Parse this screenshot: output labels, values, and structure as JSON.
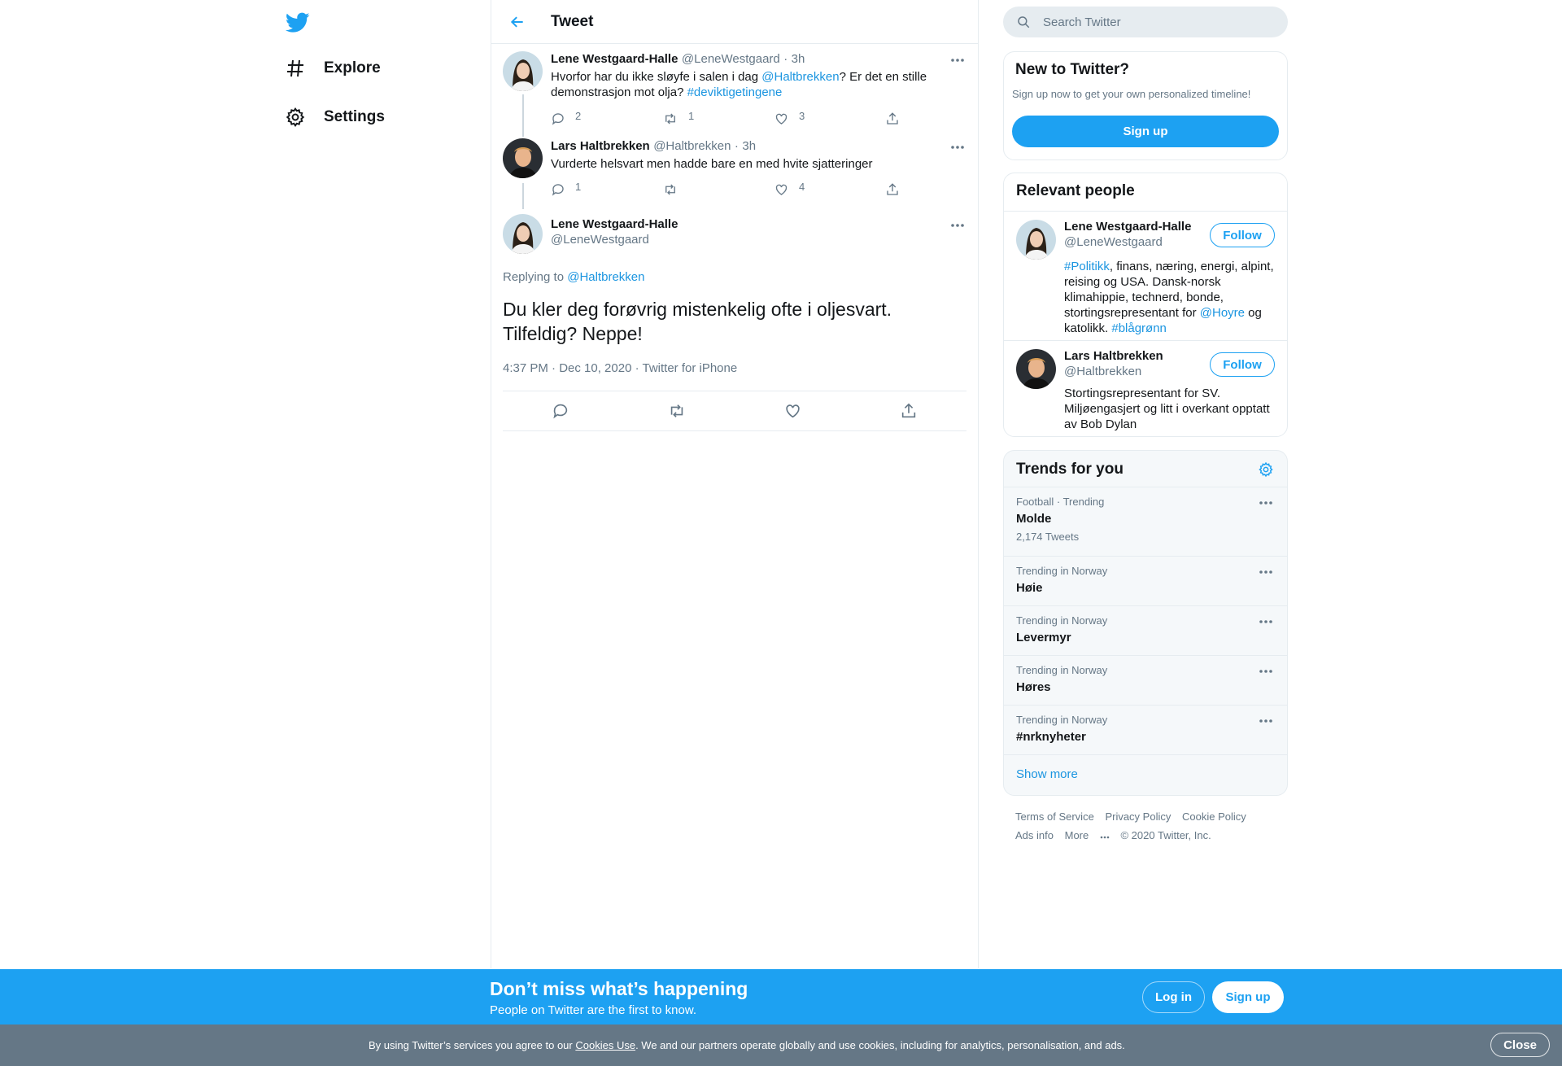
{
  "app": {
    "accent": "#1da1f2",
    "link_color": "#1b95e0"
  },
  "nav": {
    "logo_icon": "twitter-bird-icon",
    "items": [
      {
        "label": "Explore",
        "icon": "hashtag-icon"
      },
      {
        "label": "Settings",
        "icon": "gear-icon"
      }
    ]
  },
  "header": {
    "title": "Tweet",
    "back_icon": "arrow-left-icon"
  },
  "thread": [
    {
      "name": "Lene Westgaard-Halle",
      "handle": "@LeneWestgaard",
      "sep": "·",
      "time": "3h",
      "text_parts": [
        "Hvorfor har du ikke sløyfe i salen i dag ",
        "@Haltbrekken",
        "? Er det en stille demonstrasjon mot olja? ",
        "#deviktigetingene"
      ],
      "replies": "2",
      "retweets": "1",
      "likes": "3"
    },
    {
      "name": "Lars Haltbrekken",
      "handle": "@Haltbrekken",
      "sep": "·",
      "time": "3h",
      "text": "Vurderte helsvart men hadde bare en med hvite sjatteringer",
      "replies": "1",
      "retweets": "",
      "likes": "4"
    }
  ],
  "focal": {
    "name": "Lene Westgaard-Halle",
    "handle": "@LeneWestgaard",
    "replying_prefix": "Replying to ",
    "replying_to": "@Haltbrekken",
    "text_line1": "Du kler deg forøvrig mistenkelig ofte i oljesvart.",
    "text_line2": "Tilfeldig? Neppe!",
    "meta": "4:37 PM · Dec 10, 2020 · Twitter for iPhone"
  },
  "search": {
    "placeholder": "Search Twitter"
  },
  "new_to_twitter": {
    "title": "New to Twitter?",
    "subtitle": "Sign up now to get your own personalized timeline!",
    "button": "Sign up"
  },
  "relevant": {
    "title": "Relevant people",
    "people": [
      {
        "name": "Lene Westgaard-Halle",
        "handle": "@LeneWestgaard",
        "follow": "Follow",
        "bio_parts": [
          "#Politikk",
          ", finans, næring, energi, alpint, reising og USA. Dansk-norsk klimahippie, technerd, bonde, stortingsrepresentant for ",
          "@Hoyre",
          " og katolikk. ",
          "#blågrønn"
        ]
      },
      {
        "name": "Lars Haltbrekken",
        "handle": "@Haltbrekken",
        "follow": "Follow",
        "bio": "Stortingsrepresentant for SV. Miljøengasjert og litt i overkant opptatt av Bob Dylan"
      }
    ]
  },
  "trends": {
    "title": "Trends for you",
    "items": [
      {
        "context": "Football · Trending",
        "name": "Molde",
        "count": "2,174 Tweets"
      },
      {
        "context": "Trending in Norway",
        "name": "Høie"
      },
      {
        "context": "Trending in Norway",
        "name": "Levermyr"
      },
      {
        "context": "Trending in Norway",
        "name": "Høres"
      },
      {
        "context": "Trending in Norway",
        "name": "#nrknyheter"
      }
    ],
    "show_more": "Show more"
  },
  "footer": {
    "links": [
      "Terms of Service",
      "Privacy Policy",
      "Cookie Policy",
      "Ads info",
      "More"
    ],
    "copyright": "© 2020 Twitter, Inc."
  },
  "bottom_bar": {
    "title": "Don’t miss what’s happening",
    "subtitle": "People on Twitter are the first to know.",
    "login": "Log in",
    "signup": "Sign up"
  },
  "cookie": {
    "prefix": "By using Twitter’s services you agree to our ",
    "link": "Cookies Use",
    "suffix": ". We and our partners operate globally and use cookies, including for analytics, personalisation, and ads.",
    "close": "Close"
  }
}
